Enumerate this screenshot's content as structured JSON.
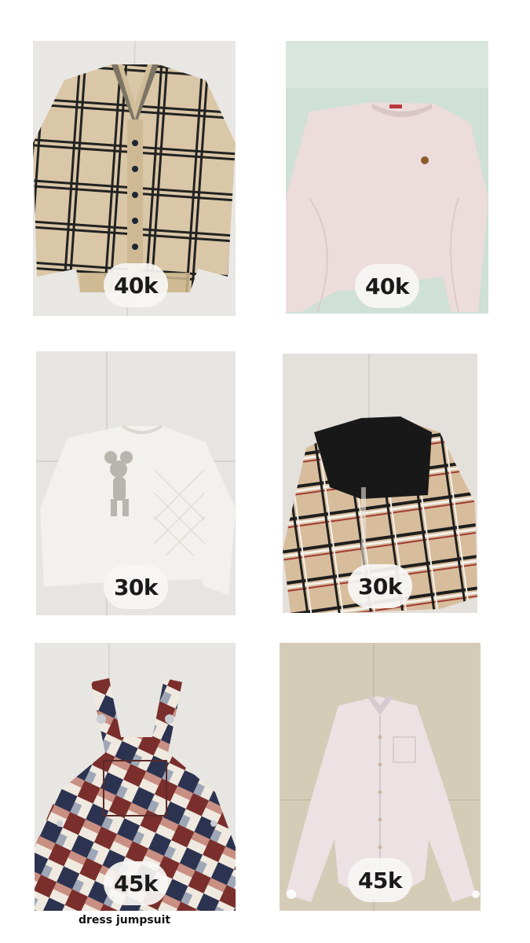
{
  "items": [
    {
      "garment": "plaid-cardigan",
      "price": "40k"
    },
    {
      "garment": "pink-sweatshirt",
      "price": "40k"
    },
    {
      "garment": "mickey-sweatshirt",
      "price": "30k"
    },
    {
      "garment": "plaid-shirt-black-knit",
      "price": "30k"
    },
    {
      "garment": "plaid-jumpsuit-dress",
      "price": "45k"
    },
    {
      "garment": "pink-button-shirt",
      "price": "45k"
    }
  ],
  "captions": {
    "item5": "dress jumpsuit"
  },
  "colors": {
    "tile_floor": "#e8e6e2",
    "green_wall": "#cfe0d6",
    "beige_floor": "#d5ccb8",
    "plaid_beige": "#d9c5a5",
    "plaid_black": "#222222",
    "pink_sweater": "#ecdcdc",
    "cream": "#f0ede8",
    "plaid_red": "#a13a35"
  }
}
